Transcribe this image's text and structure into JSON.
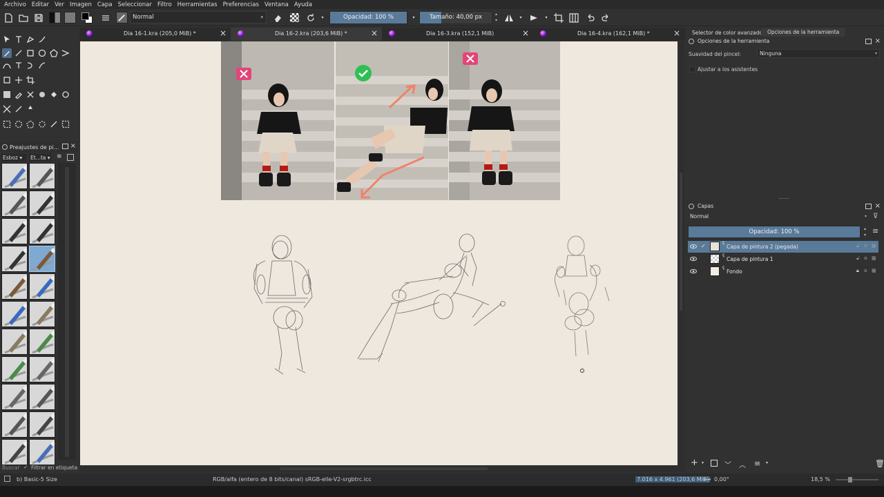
{
  "menu": [
    "Archivo",
    "Editar",
    "Ver",
    "Imagen",
    "Capa",
    "Seleccionar",
    "Filtro",
    "Herramientas",
    "Preferencias",
    "Ventana",
    "Ayuda"
  ],
  "toolbar": {
    "blend_mode": "Normal",
    "opacity": "Opacidad: 100 %",
    "size": "Tamaño: 40,00 px",
    "size_fill_fraction": 0.3
  },
  "tabs": [
    {
      "name": "Dia 16-1.kra (205,0 MiB) *"
    },
    {
      "name": "Dia 16-2.kra (203,6 MiB) *"
    },
    {
      "name": "Dia 16-3.kra (152,1 MiB)"
    },
    {
      "name": "Dia 16-4.kra (162,1 MiB) *"
    }
  ],
  "presets_docker": {
    "title": "Preajustes de pi...",
    "tag": "Esboz",
    "tag_view": "Et...ta",
    "search_placeholder": "Buscar",
    "filter_label": "Filtrar en etiqueta"
  },
  "right_docker": {
    "tabs": [
      "Selector de color avanzado",
      "Opciones de la herramienta"
    ],
    "tool_options_title": "Opciones de la herramienta",
    "smoothing_label": "Suavidad del pincel:",
    "smoothing_value": "Ninguna",
    "assistants_label": "Ajustar a los asistentes"
  },
  "layers_docker": {
    "title": "Capas",
    "blend_mode": "Normal",
    "opacity": "Opacidad:  100 %",
    "layers": [
      {
        "name": "Capa de pintura 2 (pegada)",
        "selected": true
      },
      {
        "name": "Capa de pintura 1",
        "selected": false
      },
      {
        "name": "Fondo",
        "selected": false,
        "locked": true
      }
    ]
  },
  "status": {
    "brush": "b) Basic-5 Size",
    "color_model": "RGB/alfa (entero de 8 bits/canal)  sRGB-elle-V2-srgbtrc.icc",
    "dimensions": "7.016 x 4.961 (203,6 MiB)",
    "rotation": "0,00°",
    "zoom": "18,5 %"
  },
  "colors": {
    "accent": "#5a7a99",
    "canvas": "#efe8de",
    "panel": "#313131"
  }
}
